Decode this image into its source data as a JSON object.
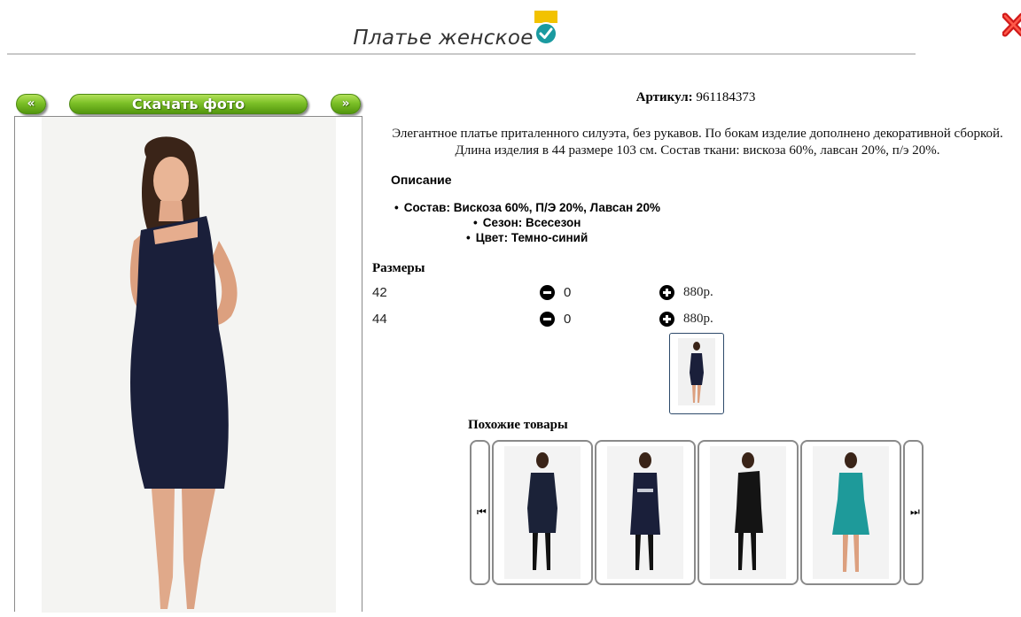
{
  "header": {
    "title": "Платье женское"
  },
  "icons": {
    "badge": "verified-badge-icon",
    "close": "close-icon"
  },
  "colors": {
    "accent_green": "#7cc027",
    "dress_navy": "#1a1f3a",
    "teal_dress": "#1e9a9a",
    "close_red": "#d11a1a"
  },
  "photo_nav": {
    "prev_label": "«",
    "download_label": "Скачать фото",
    "next_label": "»"
  },
  "product": {
    "sku_label": "Артикул:",
    "sku_value": "961184373",
    "description": "Элегантное платье приталенного силуэта, без рукавов. По бокам изделие дополнено декоративной сборкой. Длина изделия в 44 размере  103 см. Состав ткани: вискоза 60%, лавсан 20%, п/э 20%.",
    "details_heading": "Описание",
    "specs": [
      "Состав: Вискоза 60%, П/Э 20%, Лавсан 20%",
      "Сезон: Всесезон",
      "Цвет: Темно-синий"
    ]
  },
  "sizes": {
    "heading": "Размеры",
    "rows": [
      {
        "size": "42",
        "qty": "0",
        "price": "880р."
      },
      {
        "size": "44",
        "qty": "0",
        "price": "880р."
      }
    ]
  },
  "similar": {
    "heading": "Похожие товары",
    "prev_icon": "carousel-prev-icon",
    "next_icon": "carousel-next-icon"
  }
}
